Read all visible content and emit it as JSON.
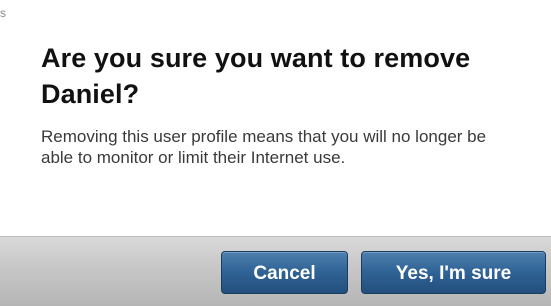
{
  "dialog": {
    "corner_mark": "s",
    "title": "Are you sure you want to remove Daniel?",
    "message": "Removing this user profile means that you will no longer be able to monitor or limit their Internet use.",
    "buttons": {
      "cancel_label": "Cancel",
      "confirm_label": "Yes, I'm sure"
    }
  },
  "colors": {
    "button_primary": "#2f6295",
    "footer_background": "#c7c7c7",
    "title_text": "#111111",
    "body_text": "#3a3a3a"
  }
}
